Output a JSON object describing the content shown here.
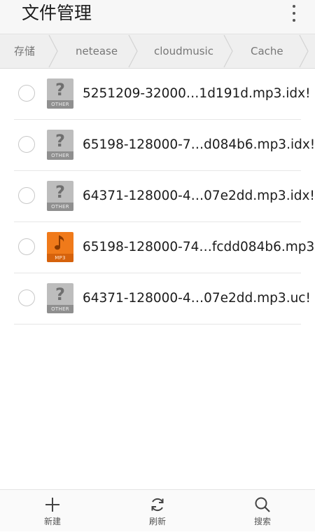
{
  "app": {
    "title": "文件管理",
    "menu_icon": "overflow-menu-icon"
  },
  "breadcrumb": [
    "存储",
    "netease",
    "cloudmusic",
    "Cache"
  ],
  "files": [
    {
      "name": "5251209-32000…1d191d.mp3.idx!",
      "type": "OTHER",
      "icon": "unknown-file-icon"
    },
    {
      "name": "65198-128000-7…d084b6.mp3.idx!",
      "type": "OTHER",
      "icon": "unknown-file-icon"
    },
    {
      "name": "64371-128000-4…07e2dd.mp3.idx!",
      "type": "OTHER",
      "icon": "unknown-file-icon"
    },
    {
      "name": "65198-128000-74…fcdd084b6.mp3",
      "type": "MP3",
      "icon": "music-file-icon"
    },
    {
      "name": "64371-128000-4…07e2dd.mp3.uc!",
      "type": "OTHER",
      "icon": "unknown-file-icon"
    }
  ],
  "toolbar": {
    "new_label": "新建",
    "refresh_label": "刷新",
    "search_label": "搜索"
  },
  "colors": {
    "mp3_accent": "#f07a1a",
    "other_icon": "#bdbdbd"
  }
}
